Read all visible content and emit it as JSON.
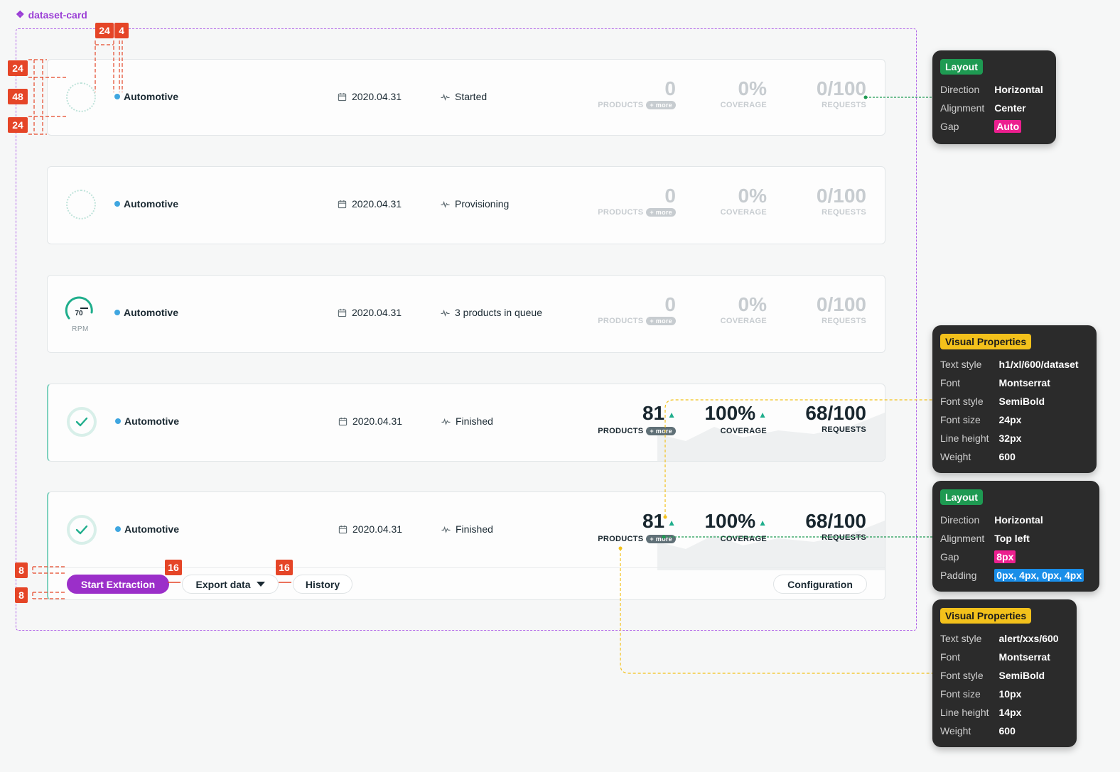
{
  "frame_label": "dataset-card",
  "cards": [
    {
      "category": "Automotive",
      "date": "2020.04.31",
      "status": "Started",
      "products": "0",
      "products_cap": "PRODUCTS",
      "more": "+ more",
      "coverage": "0%",
      "coverage_cap": "COVERAGE",
      "requests": "0/100",
      "requests_cap": "REQUESTS"
    },
    {
      "category": "Automotive",
      "date": "2020.04.31",
      "status": "Provisioning",
      "products": "0",
      "products_cap": "PRODUCTS",
      "more": "+ more",
      "coverage": "0%",
      "coverage_cap": "COVERAGE",
      "requests": "0/100",
      "requests_cap": "REQUESTS"
    },
    {
      "category": "Automotive",
      "date": "2020.04.31",
      "status": "3 products in queue",
      "rpm_value": "70",
      "rpm_label": "RPM",
      "rpm_level": 0.7,
      "products": "0",
      "products_cap": "PRODUCTS",
      "more": "+ more",
      "coverage": "0%",
      "coverage_cap": "COVERAGE",
      "requests": "0/100",
      "requests_cap": "REQUESTS"
    },
    {
      "category": "Automotive",
      "date": "2020.04.31",
      "status": "Finished",
      "products": "81",
      "products_cap": "PRODUCTS",
      "more": "+ more",
      "coverage": "100%",
      "coverage_cap": "COVERAGE",
      "requests": "68/100",
      "requests_cap": "REQUESTS"
    },
    {
      "category": "Automotive",
      "date": "2020.04.31",
      "status": "Finished",
      "products": "81",
      "products_cap": "PRODUCTS",
      "more": "+ more",
      "coverage": "100%",
      "coverage_cap": "COVERAGE",
      "requests": "68/100",
      "requests_cap": "REQUESTS",
      "actions": {
        "start": "Start Extraction",
        "export": "Export data",
        "history": "History",
        "config": "Configuration"
      }
    }
  ],
  "spacing_badges": {
    "a": "24",
    "b": "4",
    "c": "24",
    "d": "48",
    "e": "24",
    "f": "16",
    "g": "16",
    "h": "8",
    "i": "8"
  },
  "panels": {
    "layout1": {
      "title": "Layout",
      "rows": [
        [
          "Direction",
          "Horizontal"
        ],
        [
          "Alignment",
          "Center"
        ],
        [
          "Gap",
          "Auto"
        ]
      ]
    },
    "visual1": {
      "title": "Visual Properties",
      "rows": [
        [
          "Text style",
          "h1/xl/600/dataset"
        ],
        [
          "Font",
          "Montserrat"
        ],
        [
          "Font style",
          "SemiBold"
        ],
        [
          "Font size",
          "24px"
        ],
        [
          "Line height",
          "32px"
        ],
        [
          "Weight",
          "600"
        ]
      ]
    },
    "layout2": {
      "title": "Layout",
      "rows": [
        [
          "Direction",
          "Horizontal"
        ],
        [
          "Alignment",
          "Top left"
        ],
        [
          "Gap",
          "8px"
        ],
        [
          "Padding",
          "0px, 4px, 0px, 4px"
        ]
      ]
    },
    "visual2": {
      "title": "Visual Properties",
      "rows": [
        [
          "Text style",
          "alert/xxs/600"
        ],
        [
          "Font",
          "Montserrat"
        ],
        [
          "Font style",
          "SemiBold"
        ],
        [
          "Font size",
          "10px"
        ],
        [
          "Line height",
          "14px"
        ],
        [
          "Weight",
          "600"
        ]
      ]
    }
  },
  "colors": {
    "accent": "#9b2fc9",
    "success": "#1fae8c",
    "dot": "#3fa6e0",
    "redline": "#e54527",
    "frame": "#b063e8"
  }
}
